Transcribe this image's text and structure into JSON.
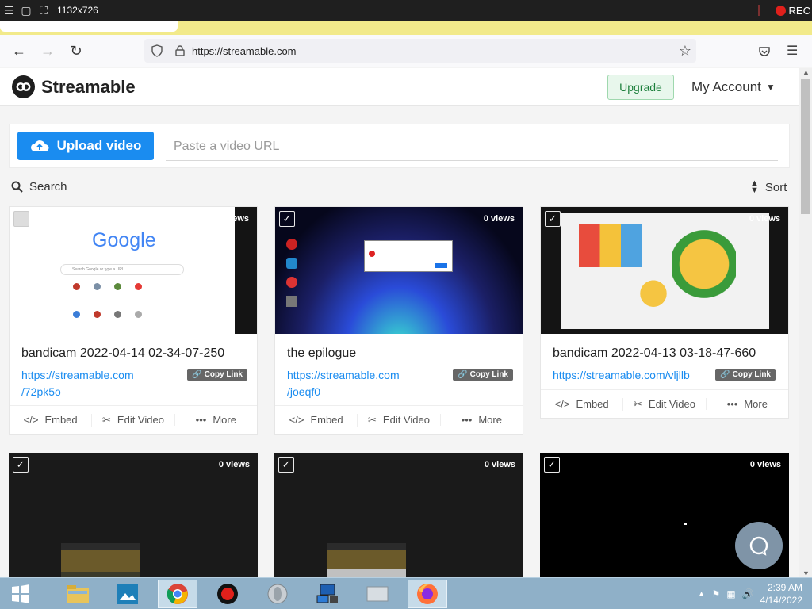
{
  "recorder": {
    "dimensions": "1132x726",
    "rec_label": "REC"
  },
  "browser": {
    "url": "https://streamable.com"
  },
  "header": {
    "brand": "Streamable",
    "upgrade_label": "Upgrade",
    "account_label": "My Account"
  },
  "upload": {
    "button_label": "Upload video",
    "url_placeholder": "Paste a video URL"
  },
  "toolbar": {
    "search_label": "Search",
    "sort_label": "Sort"
  },
  "videos": [
    {
      "title": "bandicam 2022-04-14 02-34-07-250",
      "link_line1": "https://streamable.com",
      "link_line2": "/72pk5o",
      "views": "0 views",
      "copy_label": "Copy Link"
    },
    {
      "title": "the epilogue",
      "link_line1": "https://streamable.com",
      "link_line2": "/joeqf0",
      "views": "0 views",
      "copy_label": "Copy Link"
    },
    {
      "title": "bandicam 2022-04-13 03-18-47-660",
      "link_line1": "https://streamable.com/vljllb",
      "link_line2": "",
      "views": "0 views",
      "copy_label": "Copy Link"
    },
    {
      "title": "",
      "link_line1": "",
      "link_line2": "",
      "views": "0 views",
      "copy_label": ""
    },
    {
      "title": "",
      "link_line1": "",
      "link_line2": "",
      "views": "0 views",
      "copy_label": ""
    },
    {
      "title": "",
      "link_line1": "",
      "link_line2": "",
      "views": "0 views",
      "copy_label": ""
    }
  ],
  "actions": {
    "embed": "Embed",
    "edit": "Edit Video",
    "more": "More"
  },
  "thumb_text": {
    "google": "Google",
    "google_search": "Search Google or type a URL"
  },
  "taskbar": {
    "time": "2:39 AM",
    "date": "4/14/2022"
  },
  "colors": {
    "accent": "#1a8cf0",
    "upgrade_green": "#1c7f3b",
    "rec_red": "#e0201b"
  }
}
